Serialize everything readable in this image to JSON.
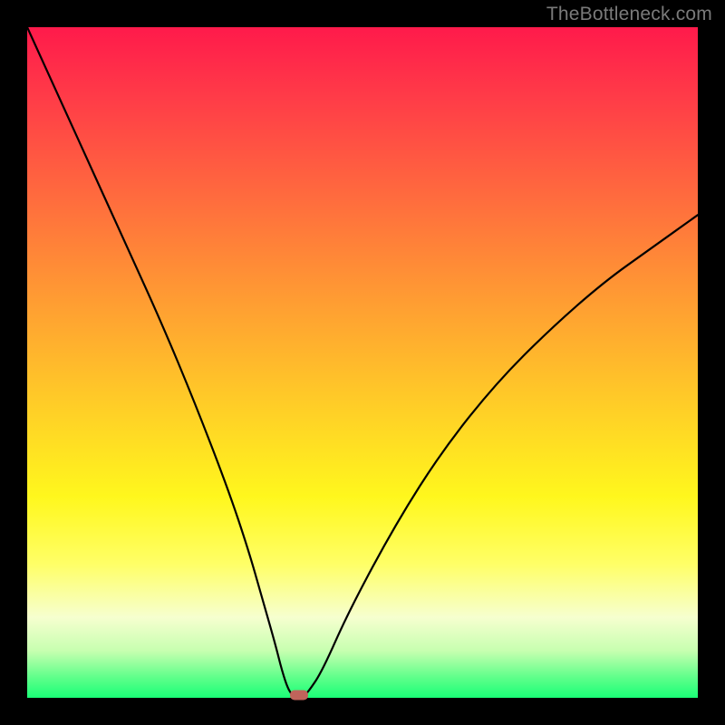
{
  "watermark": "TheBottleneck.com",
  "colors": {
    "frame_bg": "#000000",
    "curve_stroke": "#000000",
    "marker_fill": "#c0645b",
    "gradient_top": "#ff1a4b",
    "gradient_bottom": "#1aff77"
  },
  "chart_data": {
    "type": "line",
    "title": "",
    "xlabel": "",
    "ylabel": "",
    "xlim": [
      0,
      100
    ],
    "ylim": [
      0,
      100
    ],
    "grid": false,
    "legend": false,
    "note": "V-shaped bottleneck curve; minimum of curve touches bottom axis near marker. Left branch starts at top-left; right branch exits right edge at ~72% height.",
    "series": [
      {
        "name": "bottleneck-curve",
        "x": [
          0,
          5,
          10,
          15,
          20,
          25,
          30,
          33,
          35,
          37,
          38,
          39,
          40,
          41,
          42,
          44,
          48,
          55,
          62,
          70,
          78,
          86,
          93,
          100
        ],
        "y": [
          100,
          89,
          78,
          67,
          56,
          44,
          31,
          22,
          15,
          8,
          4,
          1,
          0,
          0,
          1,
          4,
          13,
          26,
          37,
          47,
          55,
          62,
          67,
          72
        ]
      }
    ],
    "annotations": [
      {
        "name": "min-marker",
        "x": 40.5,
        "y": 0,
        "shape": "rounded-rect"
      }
    ]
  }
}
